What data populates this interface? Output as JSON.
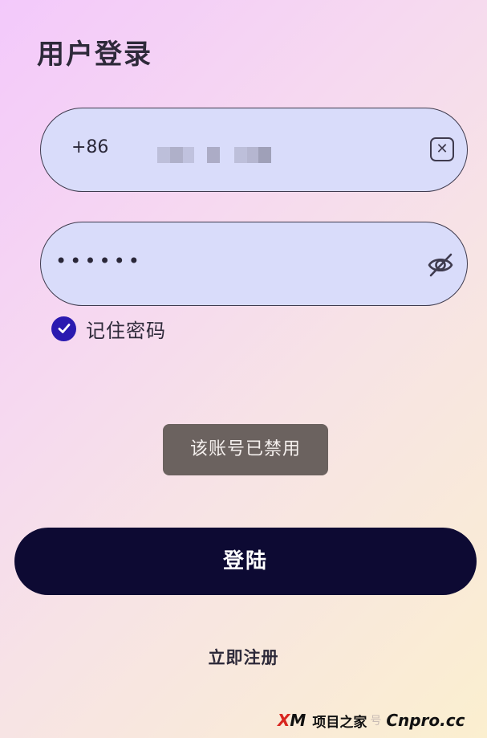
{
  "header": {
    "title": "用户登录"
  },
  "phone_field": {
    "country_code": "+86",
    "value_masked": true,
    "clear_icon": "close-icon"
  },
  "password_field": {
    "value": "••••••",
    "visibility_icon": "eye-off-icon"
  },
  "remember": {
    "label": "记住密码",
    "checked": true,
    "check_color": "#2a1ab0"
  },
  "toast": {
    "message": "该账号已禁用"
  },
  "actions": {
    "login_label": "登陆",
    "register_label": "立即注册"
  },
  "watermark": {
    "logo_x": "X",
    "logo_rest": "M",
    "name": "项目之家",
    "faint": "号",
    "site": "Cnpro.cc"
  },
  "colors": {
    "primary_button": "#0d0a33",
    "field_background": "#d9dcfa",
    "toast_background": "#6b625f"
  }
}
